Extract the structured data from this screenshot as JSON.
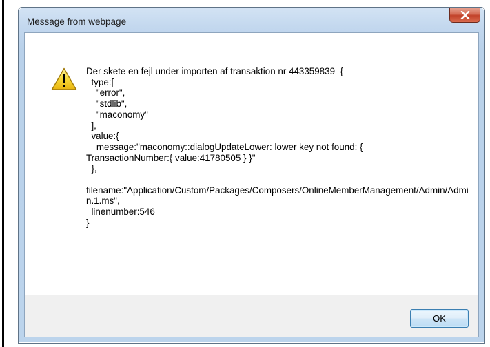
{
  "dialog": {
    "title": "Message from webpage",
    "close_icon": "close-x-icon",
    "message_icon": "warning-icon",
    "message": "Der skete en fejl under importen af transaktion nr 443359839  {\n  type:[\n    \"error\",\n    \"stdlib\",\n    \"maconomy\"\n  ],\n  value:{\n    message:\"maconomy::dialogUpdateLower: lower key not found: {\nTransactionNumber:{ value:41780505 } }\"\n  },\n\nfilename:\"Application/Custom/Packages/Composers/OnlineMemberManagement/Admin/Admin.1.ms\",\n  linenumber:546\n}",
    "ok_label": "OK"
  },
  "colors": {
    "close_button": "#c2422a",
    "warning_yellow": "#f5d01a",
    "ok_border": "#3c7fb1"
  }
}
